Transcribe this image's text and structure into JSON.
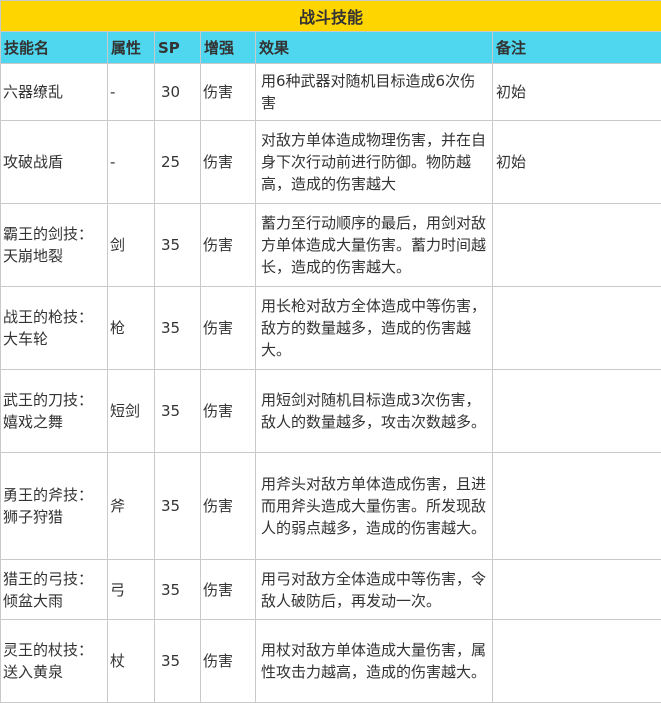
{
  "table": {
    "title": "战斗技能",
    "headers": {
      "name": "技能名",
      "attribute": "属性",
      "sp": "SP",
      "boost": "增强",
      "effect": "效果",
      "note": "备注"
    },
    "rows": [
      {
        "name": "六器缭乱",
        "attribute": "-",
        "sp": "30",
        "boost": "伤害",
        "effect": "用6种武器对随机目标造成6次伤害",
        "note": "初始"
      },
      {
        "name": "攻破战盾",
        "attribute": "-",
        "sp": "25",
        "boost": "伤害",
        "effect": "对敌方单体造成物理伤害，并在自身下次行动前进行防御。物防越高，造成的伤害越大",
        "note": "初始"
      },
      {
        "name": "霸王的剑技：天崩地裂",
        "attribute": "剑",
        "sp": "35",
        "boost": "伤害",
        "effect": "蓄力至行动顺序的最后，用剑对敌方单体造成大量伤害。蓄力时间越长，造成的伤害越大。",
        "note": ""
      },
      {
        "name": "战王的枪技：大车轮",
        "attribute": "枪",
        "sp": "35",
        "boost": "伤害",
        "effect": "用长枪对敌方全体造成中等伤害，敌方的数量越多，造成的伤害越大。",
        "note": ""
      },
      {
        "name": "武王的刀技：嬉戏之舞",
        "attribute": "短剑",
        "sp": "35",
        "boost": "伤害",
        "effect": "用短剑对随机目标造成3次伤害，敌人的数量越多，攻击次数越多。",
        "note": ""
      },
      {
        "name": "勇王的斧技：狮子狩猎",
        "attribute": "斧",
        "sp": "35",
        "boost": "伤害",
        "effect": "用斧头对敌方单体造成伤害，且进而用斧头造成大量伤害。所发现敌人的弱点越多，造成的伤害越大。",
        "note": ""
      },
      {
        "name": "猎王的弓技：倾盆大雨",
        "attribute": "弓",
        "sp": "35",
        "boost": "伤害",
        "effect": "用弓对敌方全体造成中等伤害，令敌人破防后，再发动一次。",
        "note": ""
      },
      {
        "name": "灵王的杖技：送入黄泉",
        "attribute": "杖",
        "sp": "35",
        "boost": "伤害",
        "effect": "用杖对敌方单体造成大量伤害，属性攻击力越高，造成的伤害越大。",
        "note": ""
      }
    ]
  }
}
